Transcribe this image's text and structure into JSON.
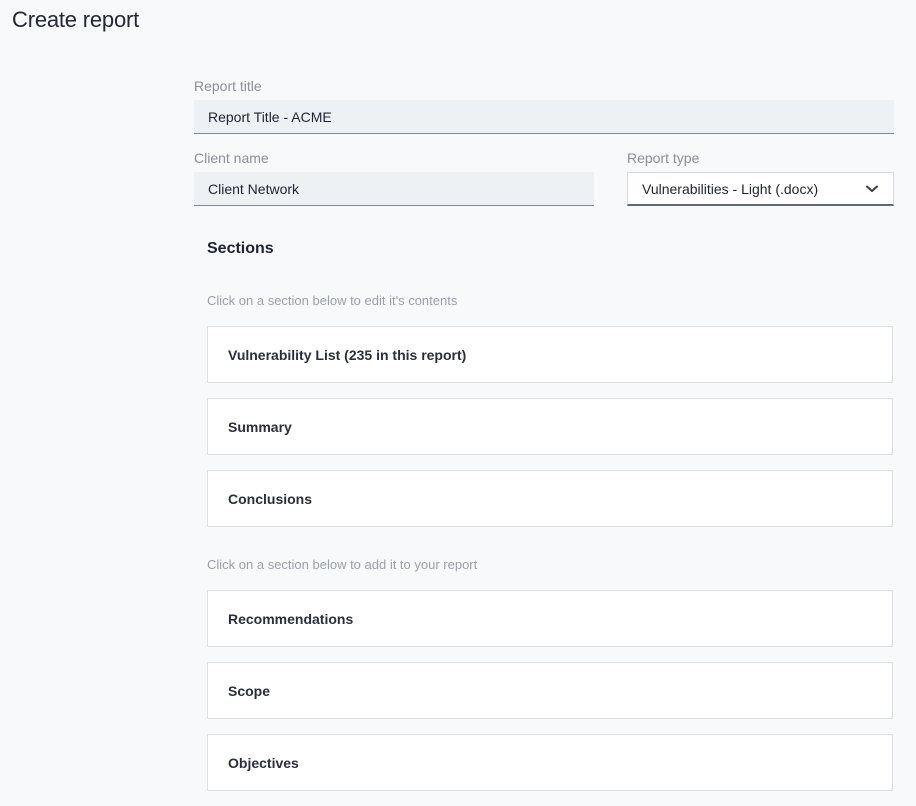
{
  "page": {
    "title": "Create report"
  },
  "form": {
    "report_title": {
      "label": "Report title",
      "value": "Report Title - ACME"
    },
    "client_name": {
      "label": "Client name",
      "value": "Client Network"
    },
    "report_type": {
      "label": "Report type",
      "value": "Vulnerabilities - Light (.docx)",
      "icon": "chevron-down-icon"
    }
  },
  "sections": {
    "heading": "Sections",
    "included_hint": "Click on a section below to edit it's contents",
    "included": [
      {
        "label": "Vulnerability List (235 in this report)"
      },
      {
        "label": "Summary"
      },
      {
        "label": "Conclusions"
      }
    ],
    "available_hint": "Click on a section below to add it to your report",
    "available": [
      {
        "label": "Recommendations"
      },
      {
        "label": "Scope"
      },
      {
        "label": "Objectives"
      }
    ]
  }
}
